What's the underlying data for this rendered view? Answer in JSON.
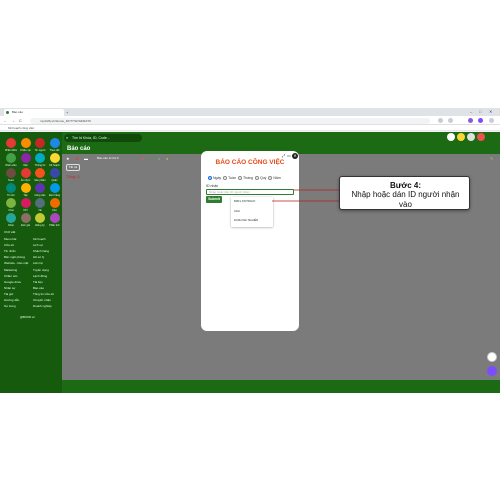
{
  "browser": {
    "tab_title": "Báo cáo",
    "new_tab": "+",
    "url": "my.bizfly.vn/Home_4077/?id=b#4107C",
    "bookmarks_label": "Kế hoạch công việc",
    "win_min": "–",
    "win_max": "□",
    "win_close": "✕",
    "back": "←",
    "forward": "→",
    "reload": "C"
  },
  "app": {
    "search_placeholder": "Tìm Id Khóa, ID, Code...",
    "page_title": "Báo cáo",
    "filter_chip": "Tất cả",
    "tong_so": "Tổng: 0",
    "toolbar_text": "Báo cáo từ lúc ▾",
    "sidebar_icons": [
      {
        "label": "Phần Mềm",
        "color": "#e53935"
      },
      {
        "label": "Khiếu nại",
        "color": "#fb8c00"
      },
      {
        "label": "Tin người",
        "color": "#c62828"
      },
      {
        "label": "Theo dõi",
        "color": "#1e88e5"
      },
      {
        "label": "Nhân viên",
        "color": "#43a047"
      },
      {
        "label": "Việc",
        "color": "#8e24aa"
      },
      {
        "label": "Thông tin",
        "color": "#00acc1"
      },
      {
        "label": "Kế hoạch",
        "color": "#fdd835"
      },
      {
        "label": "Team",
        "color": "#6d4c41"
      },
      {
        "label": "Ẩm thực",
        "color": "#e53935"
      },
      {
        "label": "Sản phẩm",
        "color": "#f4511e"
      },
      {
        "label": "Quán",
        "color": "#3949ab"
      },
      {
        "label": "Tin tức",
        "color": "#00897b"
      },
      {
        "label": "Tập",
        "color": "#ffb300"
      },
      {
        "label": "Công việc",
        "color": "#5e35b1"
      },
      {
        "label": "Đơn hàng",
        "color": "#039be5"
      },
      {
        "label": "Chat",
        "color": "#7cb342"
      },
      {
        "label": "KPI",
        "color": "#d81b60"
      },
      {
        "label": "Tài",
        "color": "#546e7a"
      },
      {
        "label": "Kho",
        "color": "#ef6c00"
      },
      {
        "label": "Khác",
        "color": "#26a69a"
      },
      {
        "label": "Đơn giá",
        "color": "#8d6e63"
      },
      {
        "label": "Đăng ký",
        "color": "#c0ca33"
      },
      {
        "label": "Phần tích",
        "color": "#ab47bc"
      }
    ],
    "menu_left": [
      "Menu bài",
      "Cửa sổ",
      "Tin nhắn",
      "Bán ngôi phòng",
      "Website - bảo mật",
      "Marketing",
      "Chăm sóc",
      "Google drive",
      "Nhân sự",
      "Tài giờ",
      "Hướng dẫn",
      "Sự trung"
    ],
    "menu_right": [
      "Kế hoạch",
      "Lịch sự",
      "Khách hàng",
      "Hồ sơ lý",
      "Liên hệ",
      "Tuyển dụng",
      "Lệnh đồng",
      "Tài liệu",
      "Báo cáo",
      "Tổng tin cửa số",
      "Chuyển nhận",
      "Doanh nghiệp"
    ],
    "footer": "@BizfID.vn",
    "section_label": "Chữ viết"
  },
  "modal": {
    "title": "BÁO CÁO CÔNG VIỆC",
    "periods": [
      "Ngày",
      "Tuần",
      "Tháng",
      "Quý",
      "Năm"
    ],
    "selected_period": "Ngày",
    "id_label": "ID nhận",
    "id_placeholder": "Nhập hoặc dán ID người nhận",
    "submit_label": "Submit",
    "dropdown_items": [
      "BIZFL FINTRACK",
      "ANH",
      "DANH NHI NGHIÊN"
    ]
  },
  "callout": {
    "title": "Bước 4:",
    "body": "Nhập hoặc dán ID người nhận vào"
  },
  "colors": {
    "app_green": "#1c6b14",
    "content_gray": "#7b7b7b",
    "title_orange": "#e64a19",
    "submit_green": "#2e7d32"
  }
}
